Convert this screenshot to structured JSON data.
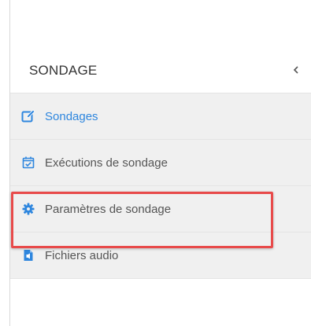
{
  "sidebar": {
    "title": "SONDAGE",
    "collapse_icon": "chevron-left-icon",
    "items": [
      {
        "label": "Sondages",
        "icon": "edit-icon",
        "active": true
      },
      {
        "label": "Exécutions de sondage",
        "icon": "calendar-check-icon",
        "active": false
      },
      {
        "label": "Paramètres de sondage",
        "icon": "gear-icon",
        "active": false
      },
      {
        "label": "Fichiers audio",
        "icon": "audio-file-icon",
        "active": false
      }
    ]
  },
  "colors": {
    "accent": "#2e86de",
    "highlight": "#e84a4a",
    "menu_bg": "#f0f0f0",
    "text": "#555555"
  }
}
